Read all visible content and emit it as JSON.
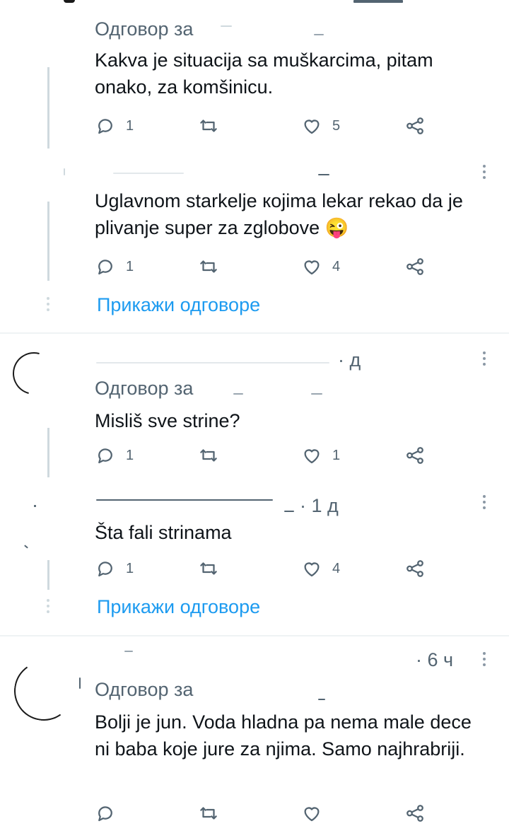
{
  "reply_label": "Одговор за",
  "show_replies_label": "Прикажи одговоре",
  "tweets": [
    {
      "text": "Kakva je situacija sa muškarcima, pitam onako, za komšinicu.",
      "replies": "1",
      "likes": "5"
    },
    {
      "text": "Uglavnom  starkelje којima lekar rekao da je plivanje super za zglobove 😜",
      "replies": "1",
      "likes": "4"
    },
    {
      "meta": "· д",
      "text": "Misliš sve strine?",
      "replies": "1",
      "likes": "1"
    },
    {
      "meta": "· 1 д",
      "text": "Šta fali strinama",
      "replies": "1",
      "likes": "4"
    },
    {
      "meta": "· 6 ч",
      "text": "Bolji je jun. Voda hladna pa nema male dece ni baba koje jure za njima. Samo najhrabriji."
    }
  ],
  "icons": {
    "reply": "reply-icon",
    "retweet": "retweet-icon",
    "like": "heart-icon",
    "share": "share-icon",
    "more": "more-vertical-icon"
  },
  "colors": {
    "link": "#1d9bf0",
    "secondary_text": "#536471",
    "text": "#0f1419",
    "divider": "#eff3f4"
  }
}
